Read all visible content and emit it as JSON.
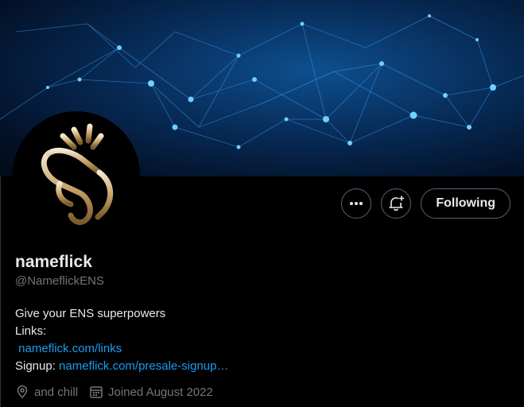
{
  "profile": {
    "display_name": "nameflick",
    "handle": "@NameflickENS",
    "bio_line1": "Give your ENS superpowers",
    "bio_links_label": "Links:",
    "links_url": "nameflick.com/links",
    "signup_label": "Signup:",
    "signup_url": "nameflick.com/presale-signup…",
    "location": "and chill",
    "joined": "Joined August 2022"
  },
  "actions": {
    "follow_label": "Following",
    "more_icon": "more-icon",
    "notify_icon": "bell-plus-icon"
  },
  "colors": {
    "link": "#1d9bf0",
    "secondary_text": "#71767b",
    "primary_text": "#e7e9ea",
    "avatar_gold": "#c9a36a"
  }
}
